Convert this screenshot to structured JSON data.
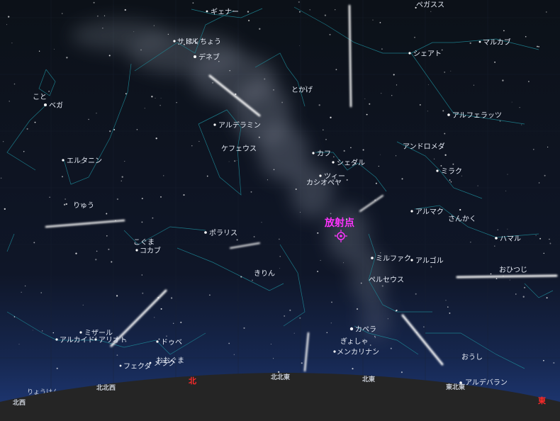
{
  "stars": [
    {
      "name": "ギェナー"
    },
    {
      "name": "サドル"
    },
    {
      "name": "はくちょう"
    },
    {
      "name": "デネブ"
    },
    {
      "name": "こと"
    },
    {
      "name": "ベガ"
    },
    {
      "name": "とかげ"
    },
    {
      "name": "アルデラミン"
    },
    {
      "name": "ケフェウス"
    },
    {
      "name": "カフ"
    },
    {
      "name": "シェダル"
    },
    {
      "name": "ツィー"
    },
    {
      "name": "カシオペヤ"
    },
    {
      "name": "エルタニン"
    },
    {
      "name": "りゅう"
    },
    {
      "name": "ポラリス"
    },
    {
      "name": "こぐま"
    },
    {
      "name": "コカブ"
    },
    {
      "name": "きりん"
    },
    {
      "name": "ペガスス"
    },
    {
      "name": "マルカブ"
    },
    {
      "name": "シェアト"
    },
    {
      "name": "アルフェラッツ"
    },
    {
      "name": "アンドロメダ"
    },
    {
      "name": "ミラク"
    },
    {
      "name": "アルマク"
    },
    {
      "name": "さんかく"
    },
    {
      "name": "ハマル"
    },
    {
      "name": "おひつじ"
    },
    {
      "name": "ミルファク"
    },
    {
      "name": "アルゴル"
    },
    {
      "name": "ペルセウス"
    },
    {
      "name": "カペラ"
    },
    {
      "name": "ぎょしゃ"
    },
    {
      "name": "メンカリナン"
    },
    {
      "name": "ミザール"
    },
    {
      "name": "アルカイド"
    },
    {
      "name": "アリオト"
    },
    {
      "name": "ドゥベ"
    },
    {
      "name": "おおぐま"
    },
    {
      "name": "メラク"
    },
    {
      "name": "フェクダ"
    },
    {
      "name": "おうし"
    },
    {
      "name": "アルデバラン"
    },
    {
      "name": "りょうけん"
    }
  ],
  "radiant": {
    "label": "放射点",
    "color": "#ff33ff"
  },
  "directions": [
    {
      "label": "北西"
    },
    {
      "label": "北北西"
    },
    {
      "label": "北"
    },
    {
      "label": "北北東"
    },
    {
      "label": "北東"
    },
    {
      "label": "東北東"
    },
    {
      "label": "東"
    }
  ],
  "colors": {
    "sky_top": "#0c1118",
    "sky_horizon": "#1f3a7a",
    "ground": "#252525",
    "constellation": "#1e8c9a",
    "red": "#ff2a2a"
  }
}
